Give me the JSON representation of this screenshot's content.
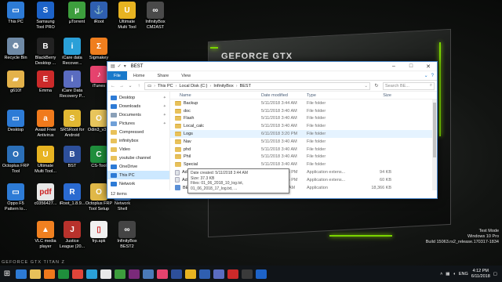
{
  "desktop": {
    "banner": "GEFORCE GTX",
    "footer_text": "GEFORCE GTX TITAN Z",
    "icons": [
      {
        "label": "This PC",
        "color": "#2d7bd6",
        "glyph": "▭"
      },
      {
        "label": "Samsung\nTool PRO",
        "color": "#1d63c8",
        "glyph": "S"
      },
      {
        "label": "µTorrent",
        "color": "#3d9e3d",
        "glyph": "µ"
      },
      {
        "label": "iRoot",
        "color": "#2f5fb0",
        "glyph": "⚓"
      },
      {
        "label": "Ultimate\nMulti Tool",
        "color": "#e7b321",
        "glyph": "U"
      },
      {
        "label": "InfinityBox\nCM2AST",
        "color": "#4a4a4a",
        "glyph": "∞"
      },
      {
        "label": "Recycle Bin",
        "color": "#6f8aa6",
        "glyph": "♻"
      },
      {
        "label": "BlackBerry\nDesktop ...",
        "color": "#222222",
        "glyph": "B"
      },
      {
        "label": "iCare data\nRecover...",
        "color": "#2aa0d8",
        "glyph": "i"
      },
      {
        "label": "Sigmakey",
        "color": "#ef7e1e",
        "glyph": "Σ"
      },
      {
        "label": "g610f",
        "color": "#e3b24a",
        "glyph": "▰"
      },
      {
        "label": "Emma",
        "color": "#cc2a2a",
        "glyph": "E"
      },
      {
        "label": "iCare Data\nRecovery P...",
        "color": "#5a6cc0",
        "glyph": "i"
      },
      {
        "label": "iTunes",
        "color": "#e6436e",
        "glyph": "♪"
      },
      {
        "label": "Desktop",
        "color": "#2d7bd6",
        "glyph": "▭"
      },
      {
        "label": "Avast Free\nAntivirus",
        "color": "#f07a1c",
        "glyph": "a"
      },
      {
        "label": "SRSRoot for\nAndroid",
        "color": "#e1b733",
        "glyph": "S"
      },
      {
        "label": "Odin3_v3.1",
        "color": "#e8c55c",
        "glyph": "O"
      },
      {
        "label": "Octoplus FRP\nTool",
        "color": "#2b6fb8",
        "glyph": "O"
      },
      {
        "label": "Ultimate\nMulti Tool...",
        "color": "#e7b321",
        "glyph": "U"
      },
      {
        "label": "BST",
        "color": "#2d4f9a",
        "glyph": "B"
      },
      {
        "label": "CS-Tool",
        "color": "#1f8e3c",
        "glyph": "C"
      },
      {
        "label": "Oppo F5\nPattern lo...",
        "color": "#2d7bd6",
        "glyph": "▭"
      },
      {
        "label": "c0356427...",
        "color": "#e8e8e8",
        "glyph": "pdf"
      },
      {
        "label": "iRoot_1.8.9...",
        "color": "#2a6ad0",
        "glyph": "R"
      },
      {
        "label": "Octoplus FRP\nTool Setup",
        "color": "#e0b848",
        "glyph": "O"
      },
      {
        "label": "Network\nShell",
        "color": "#4a7ab8",
        "glyph": "N"
      },
      {
        "label": "InfinityBox",
        "color": "#7a2a7a",
        "glyph": "∞"
      },
      {
        "label": "VLC media\nplayer",
        "color": "#f08020",
        "glyph": "▲"
      },
      {
        "label": "Justice\nLeague (20...",
        "color": "#b8322c",
        "glyph": "J"
      },
      {
        "label": "frp.apk",
        "color": "#f0f0f0",
        "glyph": "▯"
      },
      {
        "label": "InfinityBox\nBEST2",
        "color": "#444444",
        "glyph": "∞"
      }
    ]
  },
  "window": {
    "title": "BEST",
    "ribbon_tabs": [
      "File",
      "Home",
      "Share",
      "View"
    ],
    "path": [
      "This PC",
      "Local Disk (C:)",
      "InfinityBox",
      "BEST"
    ],
    "search_placeholder": "Search BE...",
    "nav_items": [
      {
        "label": "Desktop",
        "color": "#2d7bd6",
        "pinned": true,
        "indent": false,
        "selected": false
      },
      {
        "label": "Downloads",
        "color": "#2d7bd6",
        "pinned": true,
        "indent": false,
        "selected": false
      },
      {
        "label": "Documents",
        "color": "#8aa0b8",
        "pinned": true,
        "indent": false,
        "selected": false
      },
      {
        "label": "Pictures",
        "color": "#6fa0d8",
        "pinned": true,
        "indent": false,
        "selected": false
      },
      {
        "label": "Compressed",
        "color": "#e8c15a",
        "pinned": false,
        "indent": false,
        "selected": false
      },
      {
        "label": "infinitybox",
        "color": "#e8c15a",
        "pinned": false,
        "indent": false,
        "selected": false
      },
      {
        "label": "Video",
        "color": "#e8c15a",
        "pinned": false,
        "indent": false,
        "selected": false
      },
      {
        "label": "youtube channel",
        "color": "#e8c15a",
        "pinned": false,
        "indent": false,
        "selected": false
      },
      {
        "label": "OneDrive",
        "color": "#2d7bd6",
        "pinned": false,
        "indent": false,
        "selected": false
      },
      {
        "label": "This PC",
        "color": "#2d7bd6",
        "pinned": false,
        "indent": false,
        "selected": true
      },
      {
        "label": "Network",
        "color": "#2d7bd6",
        "pinned": false,
        "indent": false,
        "selected": false
      }
    ],
    "columns": {
      "name": "Name",
      "date": "Date modified",
      "type": "Type",
      "size": "Size"
    },
    "files": [
      {
        "name": "Backup",
        "date": "5/11/2018 3:44 AM",
        "type": "File folder",
        "size": "",
        "kind": "folder"
      },
      {
        "name": "doc",
        "date": "5/11/2018 3:40 AM",
        "type": "File folder",
        "size": "",
        "kind": "folder"
      },
      {
        "name": "Flash",
        "date": "5/11/2018 3:40 AM",
        "type": "File folder",
        "size": "",
        "kind": "folder"
      },
      {
        "name": "Local_calc",
        "date": "5/11/2018 3:40 AM",
        "type": "File folder",
        "size": "",
        "kind": "folder"
      },
      {
        "name": "Logs",
        "date": "6/11/2018 3:20 PM",
        "type": "File folder",
        "size": "",
        "kind": "folder"
      },
      {
        "name": "Nav",
        "date": "5/11/2018 3:40 AM",
        "type": "File folder",
        "size": "",
        "kind": "folder"
      },
      {
        "name": "phd",
        "date": "5/11/2018 3:40 AM",
        "type": "File folder",
        "size": "",
        "kind": "folder"
      },
      {
        "name": "Phil",
        "date": "5/11/2018 3:40 AM",
        "type": "File folder",
        "size": "",
        "kind": "folder"
      },
      {
        "name": "Special",
        "date": "5/11/2018 3:40 AM",
        "type": "File folder",
        "size": "",
        "kind": "folder"
      },
      {
        "name": "AdbWinApi.dll",
        "date": "2/26/2014 6:46 PM",
        "type": "Application extens...",
        "size": "94 KB",
        "kind": "dll"
      },
      {
        "name": "AdbWinUsbApi.dll",
        "date": "2/26/2014 6:46 PM",
        "type": "Application extens...",
        "size": "60 KB",
        "kind": "dll"
      },
      {
        "name": "BEST.exe",
        "date": "5/1/2017 1:05 AM",
        "type": "Application",
        "size": "18,366 KB",
        "kind": "exe"
      }
    ],
    "tooltip": {
      "line1": "Date created: 5/11/2018 3:44 AM",
      "line2": "Size: 37.3 KB",
      "line3": "Files: 01_06_2018_10_log.txt, 01_06_2018_17_log.txt, ..."
    },
    "status": "12 items"
  },
  "taskbar": {
    "start_glyph": "⊞",
    "apps": [
      "#2d7bd6",
      "#e8c15a",
      "#f07a1c",
      "#1f8e3c",
      "#e0453a",
      "#2aa0d8",
      "#e8e8e8",
      "#3d9e3d",
      "#7a2a7a",
      "#4a7ab8",
      "#e6436e",
      "#2d4f9a",
      "#e7b321",
      "#2f5fb0",
      "#5a6cc0",
      "#cc2a2a",
      "#3a3a3a",
      "#1d63c8"
    ],
    "lang": "ENG",
    "time": "4:12 PM",
    "date": "6/11/2018"
  },
  "watermark": {
    "line1": "Test Mode",
    "line2": "Windows 10 Pro",
    "line3": "Build 15063.rs2_release.170317-1834"
  }
}
